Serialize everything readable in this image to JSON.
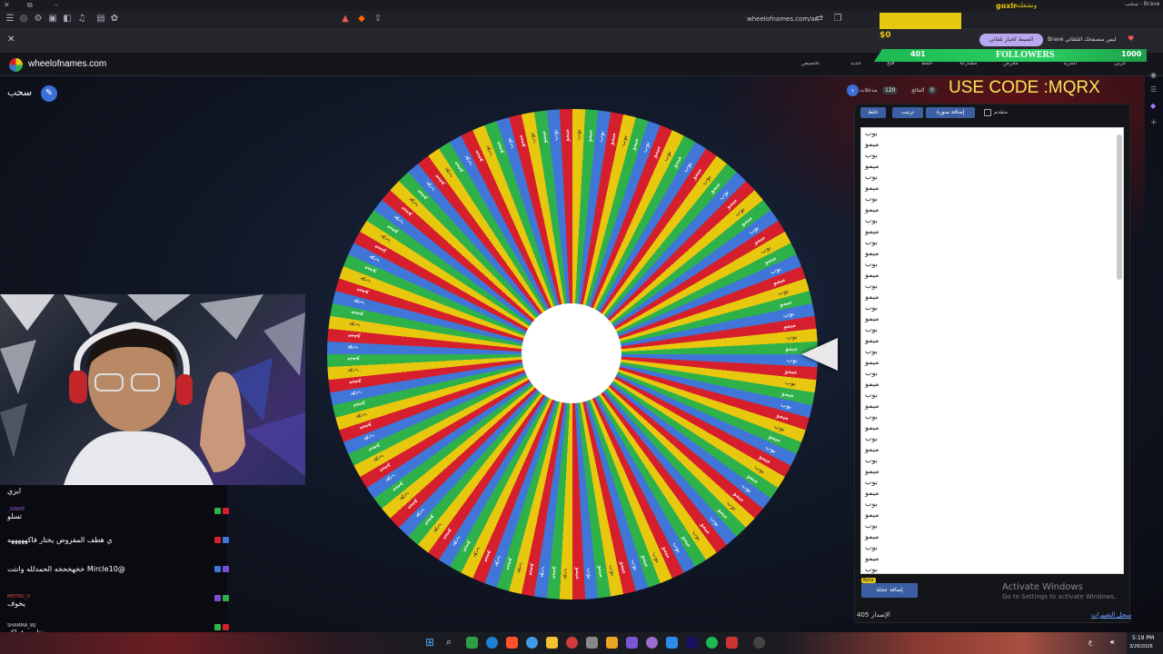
{
  "browser": {
    "title": "سحب - Brave",
    "url": "wheelofnames.com/ar",
    "site_name": "wheelofnames.com",
    "nav_items": [
      "تخصيص",
      "جديد",
      "فتح",
      "حفظ",
      "مشاركة",
      "معرض",
      "المزيد",
      "عربي"
    ],
    "brave_notice": "Brave ليس متصفحك التلقائي",
    "brave_notice_button": "الضبط كخيار تلقائي"
  },
  "wheel": {
    "title": "سحب",
    "colors": [
      "#e8c80e",
      "#2fb14a",
      "#3f76d8",
      "#d61f2c"
    ],
    "slice_count": 120,
    "labels": [
      "بوب",
      "ميمو"
    ]
  },
  "panel": {
    "tabs": [
      {
        "label": "مدخلات",
        "count": "120"
      },
      {
        "label": "النتائج",
        "count": "0"
      }
    ],
    "buttons": {
      "shuffle": "خلط",
      "sort": "ترتيب",
      "add_image": "إضافة صورة",
      "advanced": "متقدم",
      "add_wheel": "إضافة عجلة",
      "beta": "Beta"
    },
    "entries": [
      "بوب",
      "ميمو",
      "بوب",
      "ميمو",
      "بوب",
      "ميمو",
      "بوب",
      "ميمو",
      "بوب",
      "ميمو",
      "بوب",
      "ميمو",
      "بوب",
      "ميمو",
      "بوب",
      "ميمو",
      "بوب",
      "ميمو",
      "بوب",
      "ميمو",
      "بوب",
      "ميمو",
      "بوب",
      "ميمو",
      "بوب",
      "ميمو",
      "بوب",
      "ميمو",
      "بوب",
      "ميمو",
      "بوب",
      "ميمو",
      "بوب",
      "ميمو",
      "بوب",
      "ميمو",
      "بوب",
      "ميمو",
      "بوب",
      "ميمو",
      "بوب"
    ],
    "version_label": "الإصدار",
    "version": "405",
    "changelog": "سجل التغييرات"
  },
  "activation": {
    "title": "Activate Windows",
    "subtitle": "Go to Settings to activate Windows."
  },
  "overlay": {
    "use_code": "USE CODE :MQRX",
    "money": "$0",
    "followers_current": "401",
    "followers_label": "FOLLOWERS",
    "followers_goal": "1000",
    "goxlr": "goxlr",
    "header_text": "ونشغلته"
  },
  "chat": [
    {
      "name": "",
      "text": "ايزي"
    },
    {
      "name": "_GRAPE",
      "text": "تسلو"
    },
    {
      "name": "",
      "text": "ي هطف المفروض يختار فاكهههههه"
    },
    {
      "name": "",
      "text": "@Mircle10 خخهخحخه الحمدلله وانتت"
    },
    {
      "name": "MEYMO_O",
      "text": "يخوف"
    },
    {
      "name": "SHAMMA_WJ",
      "text": "يختاررر فواكه"
    }
  ],
  "clock": {
    "time": "5:19 PM",
    "date": "3/29/2026"
  }
}
